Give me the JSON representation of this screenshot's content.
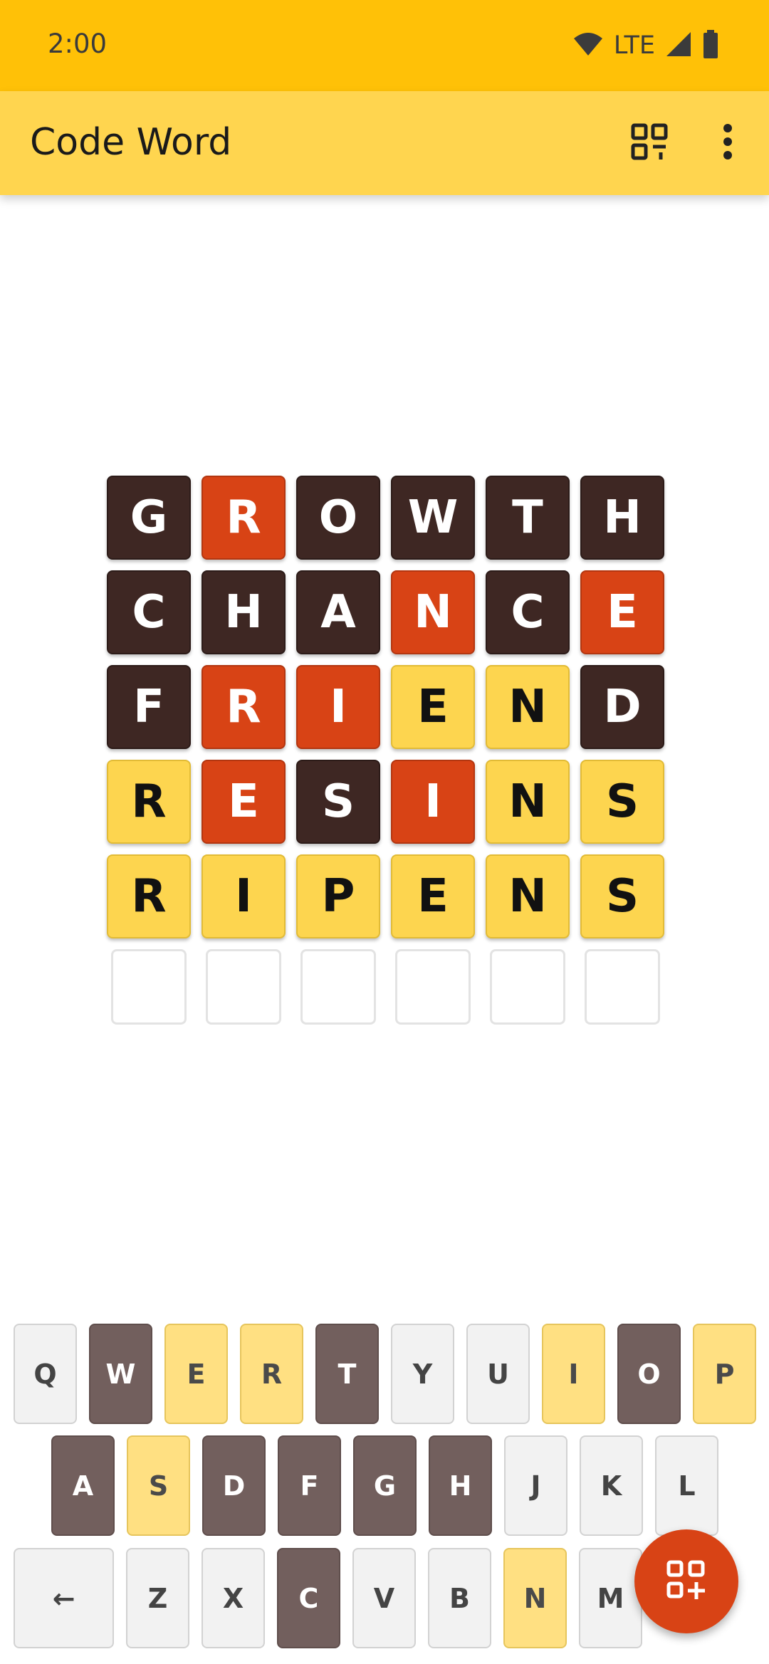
{
  "status_bar": {
    "time": "2:00",
    "network": "LTE",
    "icons": [
      "wifi-icon",
      "signal-icon",
      "battery-icon"
    ]
  },
  "app_bar": {
    "title": "Code Word",
    "actions": [
      "qr-code-icon",
      "more-vert-icon"
    ]
  },
  "colors": {
    "status_bar": "#FFC107",
    "app_bar": "#FFD54F",
    "tile_absent": "#3E2723",
    "tile_present": "#D84315",
    "tile_correct": "#FDD54F",
    "key_unused": "#F2F2F2",
    "key_absent": "#725F5D",
    "key_hit": "#FFE082",
    "fab": "#D84315"
  },
  "board": {
    "rows": [
      {
        "letters": [
          "G",
          "R",
          "O",
          "W",
          "T",
          "H"
        ],
        "states": [
          "absent",
          "present",
          "absent",
          "absent",
          "absent",
          "absent"
        ]
      },
      {
        "letters": [
          "C",
          "H",
          "A",
          "N",
          "C",
          "E"
        ],
        "states": [
          "absent",
          "absent",
          "absent",
          "present",
          "absent",
          "present"
        ]
      },
      {
        "letters": [
          "F",
          "R",
          "I",
          "E",
          "N",
          "D"
        ],
        "states": [
          "absent",
          "present",
          "present",
          "correct",
          "correct",
          "absent"
        ]
      },
      {
        "letters": [
          "R",
          "E",
          "S",
          "I",
          "N",
          "S"
        ],
        "states": [
          "correct",
          "present",
          "absent",
          "present",
          "correct",
          "correct"
        ]
      },
      {
        "letters": [
          "R",
          "I",
          "P",
          "E",
          "N",
          "S"
        ],
        "states": [
          "correct",
          "correct",
          "correct",
          "correct",
          "correct",
          "correct"
        ]
      },
      {
        "letters": [
          "",
          "",
          "",
          "",
          "",
          ""
        ],
        "states": [
          "empty",
          "empty",
          "empty",
          "empty",
          "empty",
          "empty"
        ]
      }
    ]
  },
  "keyboard": {
    "rows": [
      {
        "keys": [
          "Q",
          "W",
          "E",
          "R",
          "T",
          "Y",
          "U",
          "I",
          "O",
          "P"
        ],
        "states": [
          "unused",
          "absent",
          "hit",
          "hit",
          "absent",
          "unused",
          "unused",
          "hit",
          "absent",
          "hit"
        ]
      },
      {
        "keys": [
          "A",
          "S",
          "D",
          "F",
          "G",
          "H",
          "J",
          "K",
          "L"
        ],
        "states": [
          "absent",
          "hit",
          "absent",
          "absent",
          "absent",
          "absent",
          "unused",
          "unused",
          "unused"
        ]
      },
      {
        "keys": [
          "←",
          "Z",
          "X",
          "C",
          "V",
          "B",
          "N",
          "M"
        ],
        "states": [
          "unused",
          "unused",
          "unused",
          "absent",
          "unused",
          "unused",
          "hit",
          "unused"
        ]
      }
    ]
  },
  "fab": {
    "icon": "add-grid-icon"
  }
}
